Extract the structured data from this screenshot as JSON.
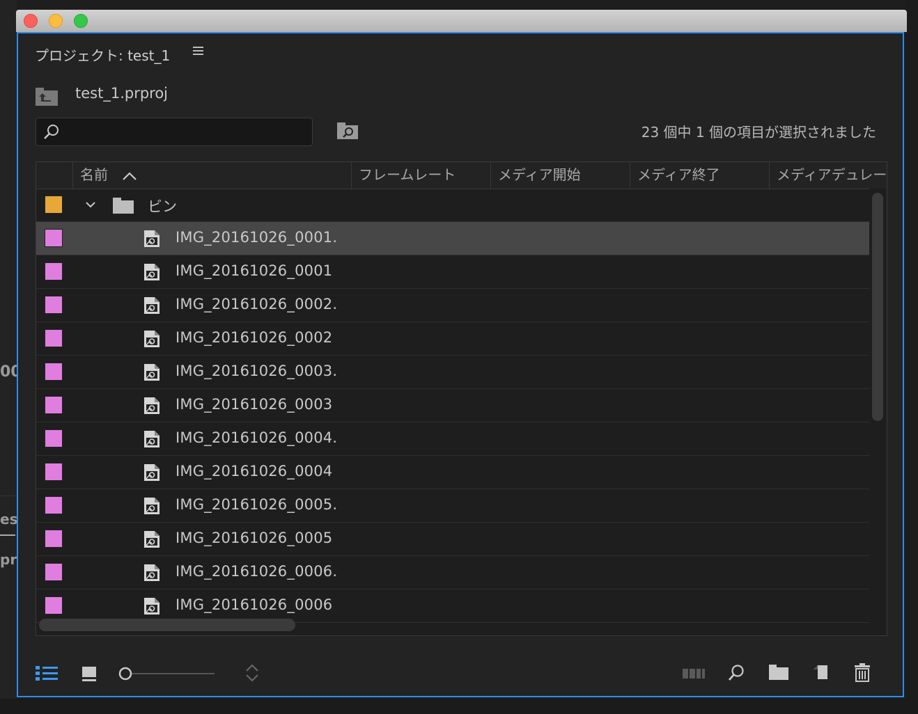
{
  "panel": {
    "title": "プロジェクト: test_1",
    "menu_icon": "hamburger-icon",
    "project_file": "test_1.prproj"
  },
  "search": {
    "placeholder": "",
    "value": ""
  },
  "status": "23 個中 1 個の項目が選択されました",
  "columns": [
    "名前",
    "フレームレート",
    "メディア開始",
    "メディア終了",
    "メディアデュレー"
  ],
  "bin": {
    "name": "ビン",
    "label_color": "#e8a838",
    "expanded": true
  },
  "items": [
    {
      "name": "IMG_20161026_0001.",
      "selected": true
    },
    {
      "name": "IMG_20161026_0001",
      "selected": false
    },
    {
      "name": "IMG_20161026_0002.",
      "selected": false
    },
    {
      "name": "IMG_20161026_0002",
      "selected": false
    },
    {
      "name": "IMG_20161026_0003.",
      "selected": false
    },
    {
      "name": "IMG_20161026_0003",
      "selected": false
    },
    {
      "name": "IMG_20161026_0004.",
      "selected": false
    },
    {
      "name": "IMG_20161026_0004",
      "selected": false
    },
    {
      "name": "IMG_20161026_0005.",
      "selected": false
    },
    {
      "name": "IMG_20161026_0005",
      "selected": false
    },
    {
      "name": "IMG_20161026_0006.",
      "selected": false
    },
    {
      "name": "IMG_20161026_0006",
      "selected": false
    }
  ],
  "item_label_color": "#e07ee0",
  "accent_color": "#2d8ceb",
  "toolbar": {
    "icons": [
      "list-view-icon",
      "icon-view-icon",
      "zoom-slider",
      "sort-icon",
      "automate-to-sequence-icon",
      "find-icon",
      "new-bin-icon",
      "new-item-icon",
      "clear-trash-icon"
    ]
  }
}
